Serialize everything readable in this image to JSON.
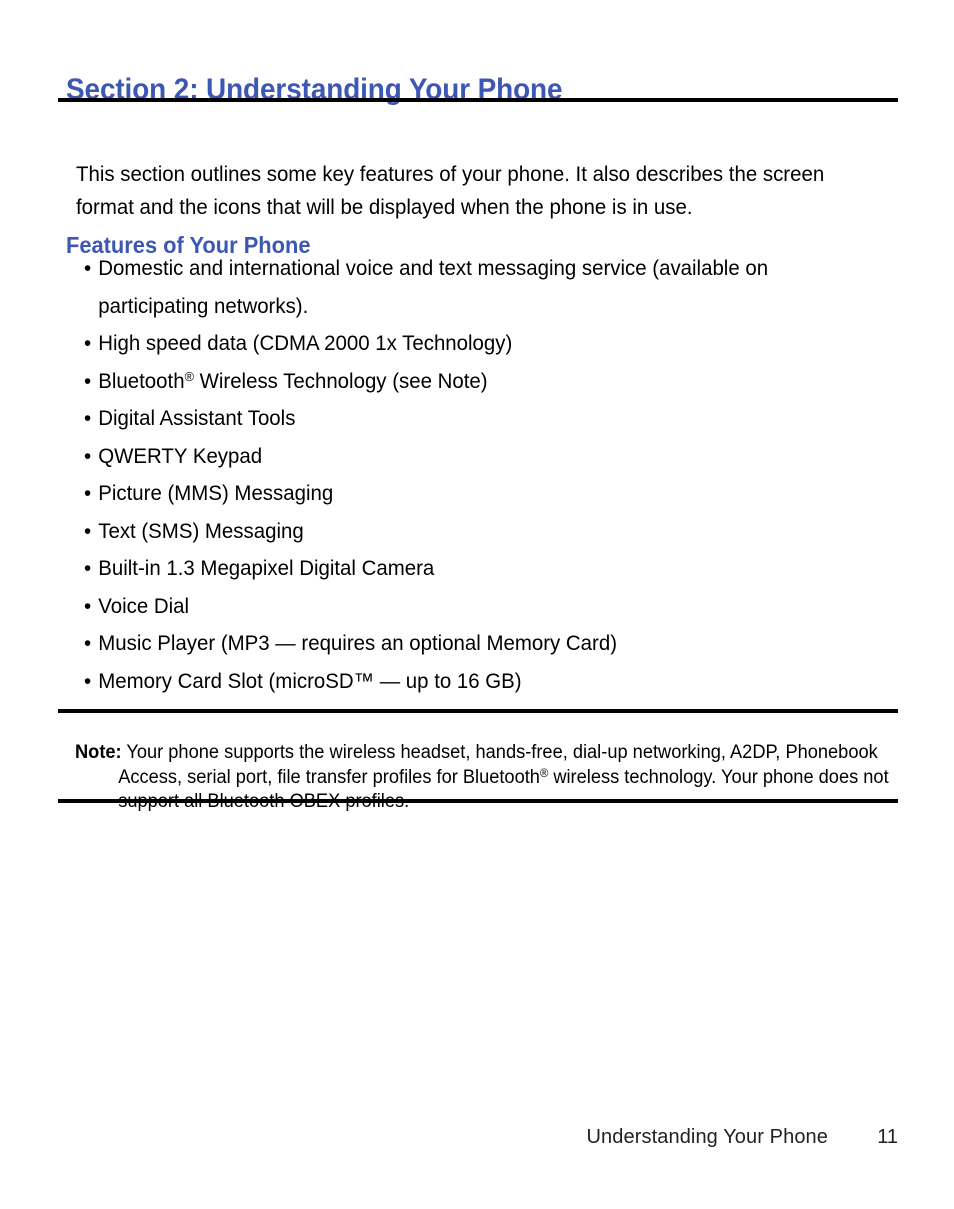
{
  "document": {
    "section_title": "Section 2: Understanding Your Phone",
    "intro_paragraph": "This section outlines some key features of your phone. It also describes the screen format and the icons that will be displayed when the phone is in use.",
    "sub_heading": "Features of Your Phone",
    "bullet_glyph": "•",
    "features": [
      {
        "text_before_sup": "Domestic and international voice and text messaging service (available on participating networks).",
        "sup": "",
        "text_after_sup": ""
      },
      {
        "text_before_sup": "High speed data (CDMA 2000 1x Technology)",
        "sup": "",
        "text_after_sup": ""
      },
      {
        "text_before_sup": "Bluetooth",
        "sup": "®",
        "text_after_sup": " Wireless Technology (see Note)"
      },
      {
        "text_before_sup": "Digital Assistant Tools",
        "sup": "",
        "text_after_sup": ""
      },
      {
        "text_before_sup": "QWERTY Keypad",
        "sup": "",
        "text_after_sup": ""
      },
      {
        "text_before_sup": "Picture (MMS) Messaging",
        "sup": "",
        "text_after_sup": ""
      },
      {
        "text_before_sup": "Text (SMS) Messaging",
        "sup": "",
        "text_after_sup": ""
      },
      {
        "text_before_sup": "Built-in 1.3 Megapixel Digital Camera",
        "sup": "",
        "text_after_sup": ""
      },
      {
        "text_before_sup": "Voice Dial",
        "sup": "",
        "text_after_sup": ""
      },
      {
        "text_before_sup": "Music Player (MP3 — requires an optional Memory Card)",
        "sup": "",
        "text_after_sup": ""
      },
      {
        "text_before_sup": "Memory Card Slot (microSD™ — up to 16 GB)",
        "sup": "",
        "text_after_sup": ""
      }
    ],
    "note": {
      "label": "Note:",
      "text_part1": " Your phone supports the wireless headset, hands-free, dial-up networking, A2DP, Phonebook Access, serial port, file transfer profiles for Bluetooth",
      "sup": "®",
      "text_part2": " wireless technology. Your phone does not support all Bluetooth OBEX profiles."
    },
    "footer": {
      "title": "Understanding Your Phone",
      "page_number": "11"
    },
    "colors": {
      "heading_blue": "#3c57b4",
      "body_black": "#000000",
      "rule_black": "#000000",
      "page_background": "#ffffff"
    }
  }
}
